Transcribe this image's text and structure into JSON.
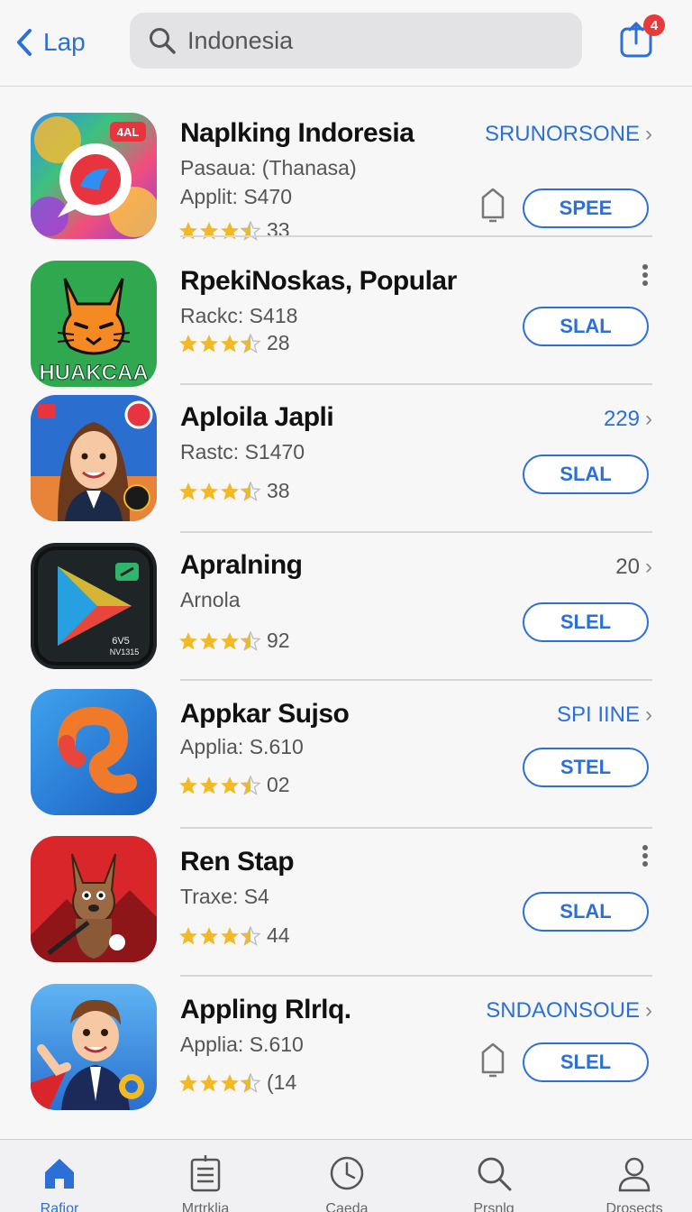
{
  "header": {
    "back_label": "Lap",
    "search_value": "Indonesia",
    "notification_count": "4"
  },
  "apps": [
    {
      "title": "Naplking Indoresia",
      "sub1": "Pasaua: (Thanasa)",
      "sub2": "Applit: S470",
      "rating_count": "33",
      "link": "SRUNORSONE",
      "button": "SPEE",
      "icon": "chat-bubble-icon",
      "has_bell": true
    },
    {
      "title": "RpekiNoskas, Popular",
      "sub1": "Rackc: S418",
      "sub2": "",
      "rating_count": "28",
      "link": "",
      "button": "SLAL",
      "icon": "cat-icon",
      "icon_text": "HUAKCAA",
      "has_more": true
    },
    {
      "title": "Aploila Japli",
      "sub1": "Rastc: S1470",
      "sub2": "",
      "rating_count": "38",
      "link": "229",
      "button": "SLAL",
      "icon": "woman-avatar-icon"
    },
    {
      "title": "Apralning",
      "sub1": "Arnola",
      "sub2": "",
      "rating_count": "92",
      "link": "20",
      "link_gray": true,
      "button": "SLEL",
      "icon": "play-store-icon"
    },
    {
      "title": "Appkar Sujso",
      "sub1": "Applia: S.610",
      "sub2": "",
      "rating_count": "02",
      "link": "SPI IINE",
      "button": "STEL",
      "icon": "hook-icon"
    },
    {
      "title": "Ren Stap",
      "sub1": "Traxe: S4",
      "sub2": "",
      "rating_count": "44",
      "link": "",
      "button": "SLAL",
      "icon": "fox-character-icon",
      "has_more": true
    },
    {
      "title": "Appling Rlrlq.",
      "sub1": "Applia: S.610",
      "sub2": "",
      "rating_count": "(14",
      "link": "SNDAONSOUE",
      "button": "SLEL",
      "icon": "businessman-avatar-icon",
      "has_bell": true
    }
  ],
  "tabs": [
    {
      "label": "Rafior",
      "icon": "home-icon",
      "active": true
    },
    {
      "label": "Mrtrklia",
      "icon": "clipboard-icon"
    },
    {
      "label": "Caeda",
      "icon": "clock-icon"
    },
    {
      "label": "Prsnlg",
      "icon": "search-icon"
    },
    {
      "label": "Drosects",
      "icon": "person-icon"
    }
  ],
  "colors": {
    "accent": "#2c6fd6",
    "badge": "#e83a3a",
    "star": "#f2b926"
  }
}
